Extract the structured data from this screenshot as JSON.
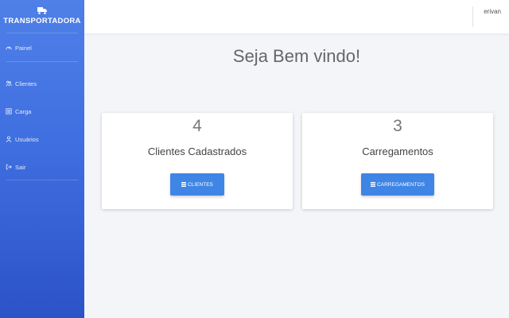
{
  "brand": {
    "name": "TRANSPORTADORA",
    "icon": "truck-icon"
  },
  "sidebar": {
    "items": [
      {
        "label": "Painel",
        "icon": "dashboard-icon"
      },
      {
        "label": "Clientes",
        "icon": "users-icon"
      },
      {
        "label": "Carga",
        "icon": "list-icon"
      },
      {
        "label": "Usuários",
        "icon": "user-icon"
      },
      {
        "label": "Sair",
        "icon": "logout-icon"
      }
    ]
  },
  "header": {
    "user": "erivan"
  },
  "main": {
    "welcome": "Seja Bem vindo!",
    "cards": [
      {
        "count": "4",
        "label": "Clientes Cadastrados",
        "button": "CLIENTES"
      },
      {
        "count": "3",
        "label": "Carregamentos",
        "button": "CARREGAMENTOS"
      }
    ]
  },
  "colors": {
    "sidebar_top": "#4f80e8",
    "sidebar_bottom": "#2c52c7",
    "button": "#3f85e6",
    "background": "#f3f5f9"
  }
}
